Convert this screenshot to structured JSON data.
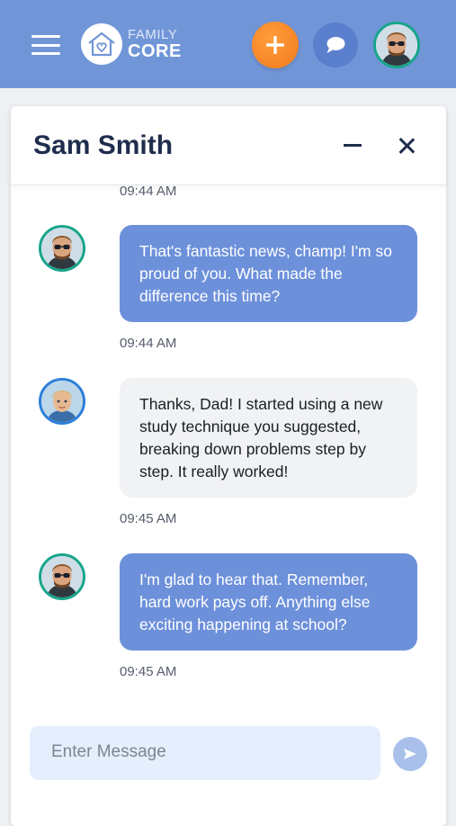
{
  "header": {
    "logo_top": "FAMILY",
    "logo_bottom": "CORE",
    "icons": {
      "menu": "hamburger-menu-icon",
      "add": "plus-icon",
      "chat": "chat-bubble-icon"
    },
    "colors": {
      "bar": "#7196d8",
      "add": "#f58a2a",
      "chat": "#5a7fcd"
    }
  },
  "chat": {
    "contact_name": "Sam Smith",
    "messages": [
      {
        "sender": "dad",
        "text": "That's fantastic news, champ! I'm so proud of you. What made the difference this time?",
        "time": "09:44 AM"
      },
      {
        "sender": "son",
        "text": "Thanks, Dad! I started using a new study technique you suggested, breaking down problems step by step. It really worked!",
        "time": "09:45 AM"
      },
      {
        "sender": "dad",
        "text": "I'm glad to hear that. Remember, hard work pays off.  Anything else exciting happening at school?",
        "time": "09:45 AM"
      }
    ],
    "previous_time": "09:44 AM",
    "input_placeholder": "Enter Message",
    "colors": {
      "outgoing": "#6d90da",
      "incoming": "#f1f2f4"
    }
  }
}
